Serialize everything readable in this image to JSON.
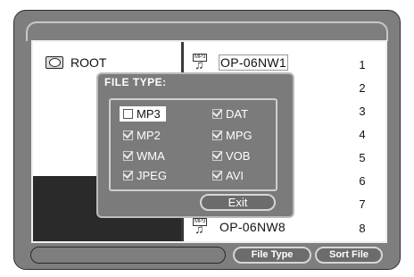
{
  "browser": {
    "root_label": "ROOT",
    "files": [
      {
        "name": "OP-06NW1",
        "num": "1",
        "selected": true
      },
      {
        "name": "",
        "num": "2"
      },
      {
        "name": "",
        "num": "3"
      },
      {
        "name": "",
        "num": "4"
      },
      {
        "name": "",
        "num": "5"
      },
      {
        "name": "",
        "num": "6"
      },
      {
        "name": "",
        "num": "7"
      },
      {
        "name": "OP-06NW8",
        "num": "8"
      }
    ],
    "partial_fragments": [
      "2",
      "3",
      "4",
      "5",
      "6",
      "7"
    ]
  },
  "dialog": {
    "title": "FILE TYPE:",
    "options": [
      {
        "label": "MP3",
        "checked": false,
        "selected": true
      },
      {
        "label": "DAT",
        "checked": true
      },
      {
        "label": "MP2",
        "checked": true
      },
      {
        "label": "MPG",
        "checked": true
      },
      {
        "label": "WMA",
        "checked": true
      },
      {
        "label": "VOB",
        "checked": true
      },
      {
        "label": "JPEG",
        "checked": true
      },
      {
        "label": "AVI",
        "checked": true
      }
    ],
    "exit_label": "Exit"
  },
  "bottom": {
    "file_type_label": "File Type",
    "sort_file_label": "Sort File"
  },
  "icons": {
    "root": "disc-icon",
    "file": "mp3-file-icon",
    "mp3_tag": "MP3"
  },
  "colors": {
    "frame": "#7e7e7e",
    "dialog": "#7b7b7b",
    "dark_pane": "#2a2a2a"
  }
}
